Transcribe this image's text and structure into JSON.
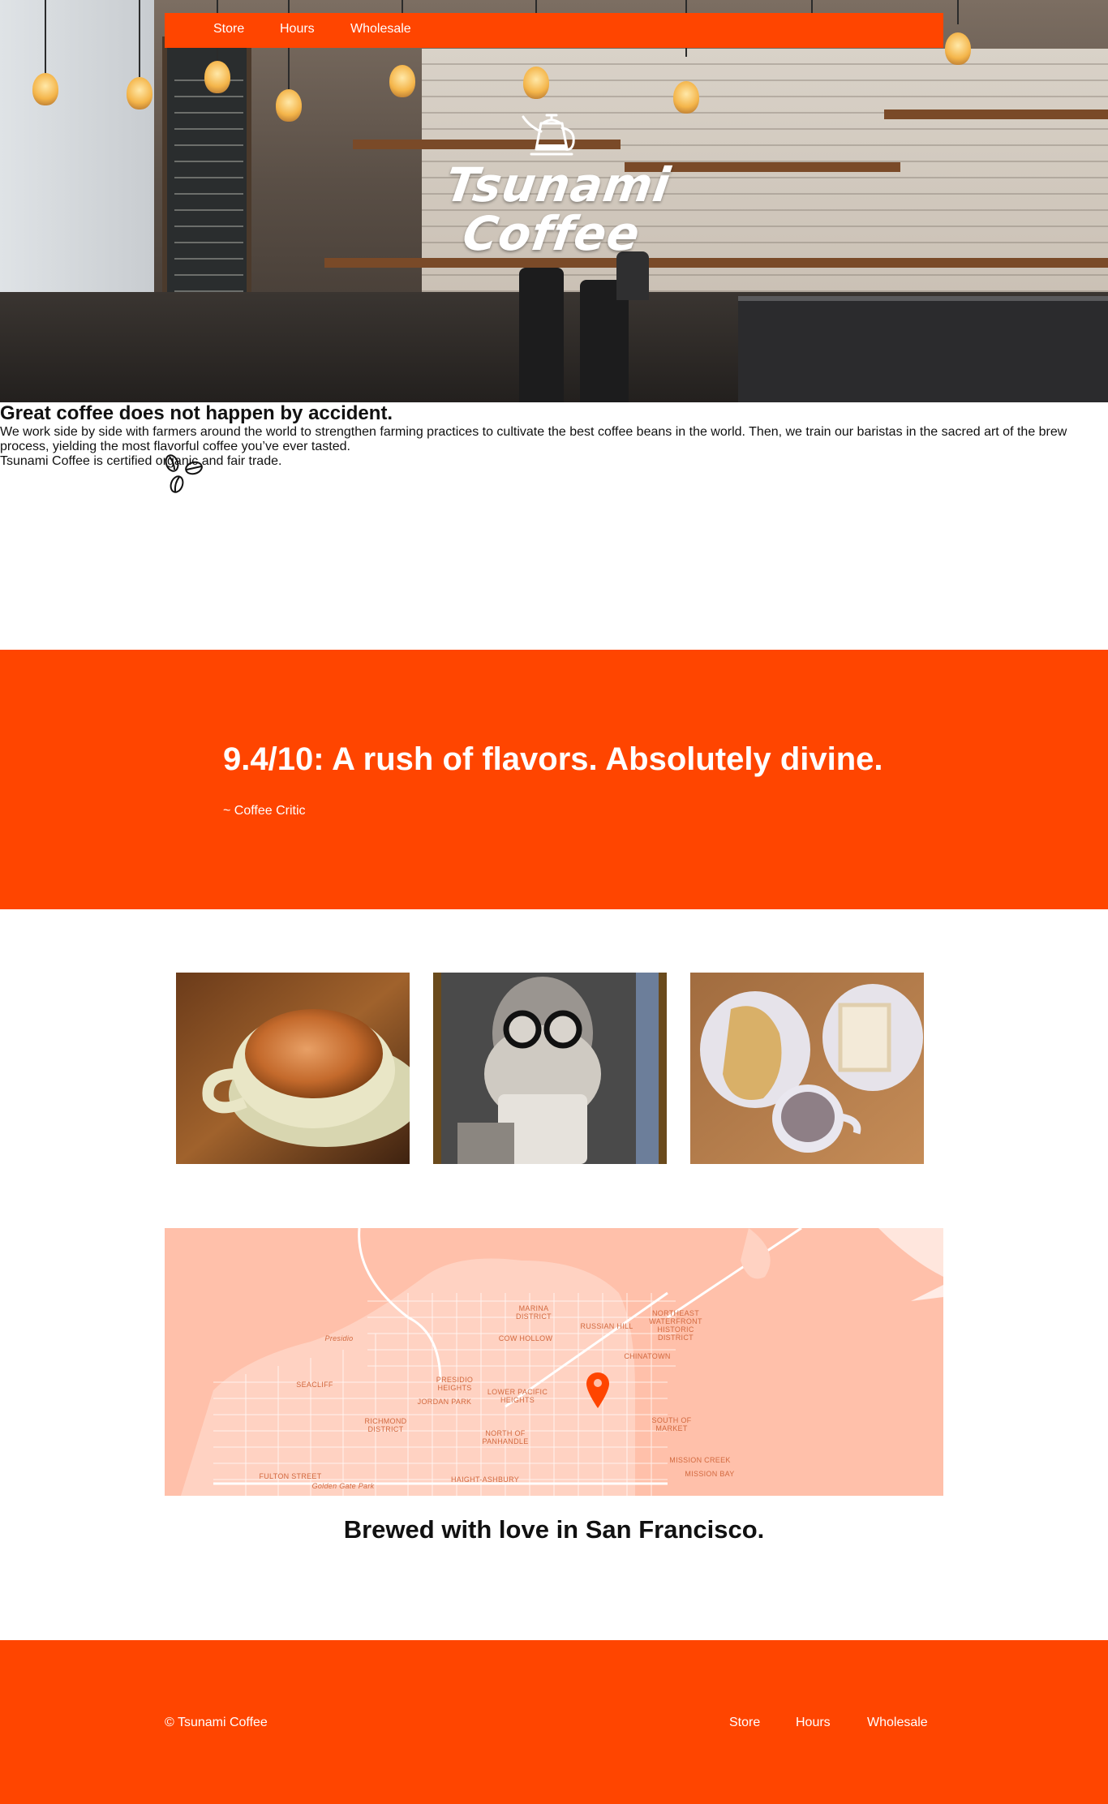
{
  "nav": {
    "items": [
      "Store",
      "Hours",
      "Wholesale"
    ]
  },
  "hero": {
    "logo_line1": "Tsunami",
    "logo_line2": "Coffee",
    "logo_icon": "kettle-icon"
  },
  "intro": {
    "icon": "coffee-beans-icon",
    "heading": "Great coffee does not happen by accident.",
    "paragraph1": "We work side by side with farmers around the world to strengthen farming practices to cultivate the best coffee beans in the world. Then, we train our baristas in the sacred art of the brew process, yielding the most flavorful coffee you’ve ever tasted.",
    "paragraph2": "Tsunami Coffee is certified organic and fair trade."
  },
  "quote": {
    "text": "9.4/10: A rush of flavors. Absolutely divine.",
    "attribution": "~ Coffee Critic"
  },
  "gallery": {
    "photos": [
      "latte-photo",
      "bearded-man-drinking-coffee-photo",
      "breakfast-plates-photo"
    ]
  },
  "map": {
    "labels": [
      "MARINA DISTRICT",
      "NORTHEAST WATERFRONT HISTORIC DISTRICT",
      "RUSSIAN HILL",
      "COW HOLLOW",
      "Presidio",
      "CHINATOWN",
      "SEACLIFF",
      "PRESIDIO HEIGHTS",
      "JORDAN PARK",
      "LOWER PACIFIC HEIGHTS",
      "RICHMOND DISTRICT",
      "NORTH OF PANHANDLE",
      "SOUTH OF MARKET",
      "MISSION CREEK",
      "MISSION BAY",
      "FULTON STREET",
      "Golden Gate Park",
      "HAIGHT-ASHBURY"
    ],
    "caption": "Brewed with love in San Francisco."
  },
  "footer": {
    "copyright": "© Tsunami Coffee",
    "links": [
      "Store",
      "Hours",
      "Wholesale"
    ]
  },
  "colors": {
    "accent": "#ff4500",
    "map_land": "#ffc0aa",
    "map_pin": "#ff4500"
  }
}
